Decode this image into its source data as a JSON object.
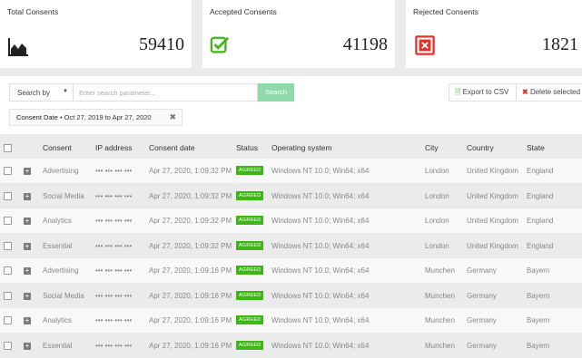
{
  "cards": [
    {
      "title": "Total Consents",
      "value": "59410",
      "icon": "area-chart-icon"
    },
    {
      "title": "Accepted Consents",
      "value": "41198",
      "icon": "check-square-icon",
      "color": "#3fb618"
    },
    {
      "title": "Rejected Consents",
      "value": "1821",
      "icon": "x-square-icon",
      "color": "#e0342a"
    }
  ],
  "filters": {
    "search_by_label": "Search by",
    "search_placeholder": "Enter search parameter...",
    "search_button": "Search",
    "export_label": "Export to CSV",
    "delete_label": "Delete selected",
    "chip_key": "Consent Date",
    "chip_value": "• Oct 27, 2019 to Apr 27, 2020"
  },
  "table": {
    "columns": [
      "Consent",
      "IP address",
      "Consent date",
      "Status",
      "Operating system",
      "City",
      "Country",
      "State"
    ],
    "rows": [
      [
        "Advertising",
        "••• ••• ••• •••",
        "Apr 27, 2020, 1:09:32 PM",
        "AGREED",
        "Windows NT 10.0; Win64; x64",
        "London",
        "United Kingdom",
        "England"
      ],
      [
        "Social Media",
        "••• ••• ••• •••",
        "Apr 27, 2020, 1:09:32 PM",
        "AGREED",
        "Windows NT 10.0; Win64; x64",
        "London",
        "United Kingdom",
        "England"
      ],
      [
        "Analytics",
        "••• ••• ••• •••",
        "Apr 27, 2020, 1:09:32 PM",
        "AGREED",
        "Windows NT 10.0; Win64; x64",
        "London",
        "United Kingdom",
        "England"
      ],
      [
        "Essential",
        "••• ••• ••• •••",
        "Apr 27, 2020, 1:09:32 PM",
        "AGREED",
        "Windows NT 10.0; Win64; x64",
        "London",
        "United Kingdom",
        "England"
      ],
      [
        "Advertising",
        "••• ••• ••• •••",
        "Apr 27, 2020, 1:09:16 PM",
        "AGREED",
        "Windows NT 10.0; Win64; x64",
        "Munchen",
        "Germany",
        "Bayern"
      ],
      [
        "Social Media",
        "••• ••• ••• •••",
        "Apr 27, 2020, 1:09:16 PM",
        "AGREED",
        "Windows NT 10.0; Win64; x64",
        "Munchen",
        "Germany",
        "Bayern"
      ],
      [
        "Analytics",
        "••• ••• ••• •••",
        "Apr 27, 2020, 1:09:16 PM",
        "AGREED",
        "Windows NT 10.0; Win64; x64",
        "Munchen",
        "Germany",
        "Bayern"
      ],
      [
        "Essential",
        "••• ••• ••• •••",
        "Apr 27, 2020, 1:09:16 PM",
        "AGREED",
        "Windows NT 10.0; Win64; x64",
        "Munchen",
        "Germany",
        "Bayern"
      ]
    ]
  }
}
